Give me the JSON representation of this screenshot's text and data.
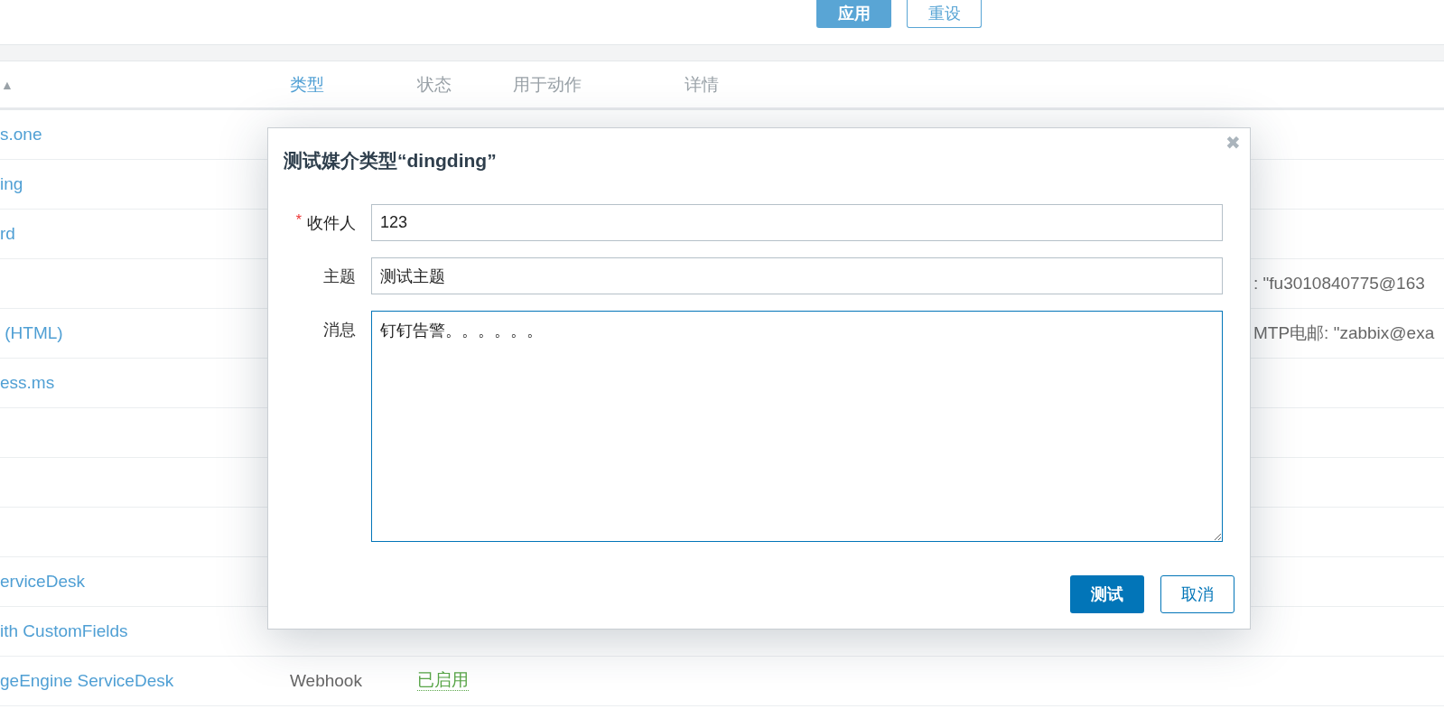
{
  "filter_buttons": [
    {
      "label": "应用",
      "kind": "primary"
    },
    {
      "label": "重设",
      "kind": "secondary"
    }
  ],
  "table": {
    "sort_arrow": "▲",
    "columns": [
      {
        "label": "类型",
        "sortable": true
      },
      {
        "label": "状态",
        "sortable": false
      },
      {
        "label": "用于动作",
        "sortable": false
      },
      {
        "label": "详情",
        "sortable": false
      }
    ],
    "rows": [
      {
        "name": "s.one"
      },
      {
        "name": "ing"
      },
      {
        "name": "rd"
      },
      {
        "details": ": \"fu3010840775@163"
      },
      {
        "name": " (HTML)",
        "details": "MTP电邮: \"zabbix@exa"
      },
      {
        "name": "ess.ms"
      },
      {},
      {},
      {},
      {
        "name": "erviceDesk"
      },
      {
        "name": "ith CustomFields"
      },
      {
        "name": "geEngine ServiceDesk",
        "type": "Webhook",
        "status": "已启用"
      }
    ]
  },
  "dialog": {
    "title": "测试媒介类型“dingding”",
    "close": "✖",
    "fields": [
      {
        "label": "收件人",
        "required": true,
        "required_mark": "*",
        "kind": "input",
        "value": "123",
        "focused": false
      },
      {
        "label": "主题",
        "required": false,
        "kind": "input",
        "value": "测试主题",
        "focused": false
      },
      {
        "label": "消息",
        "required": false,
        "kind": "textarea",
        "value": "钉钉告警。。。。。。",
        "focused": true
      }
    ],
    "buttons": [
      {
        "label": "测试",
        "kind": "primary"
      },
      {
        "label": "取消",
        "kind": "secondary"
      }
    ]
  }
}
